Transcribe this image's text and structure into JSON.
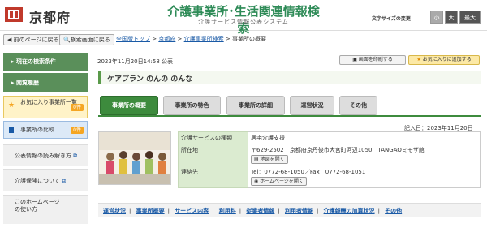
{
  "header": {
    "pref_name": "京都府",
    "site_title": "介護事業所･生活関連情報検索",
    "site_subtitle": "介護サービス情報公表システム",
    "font_size_label": "文字サイズの変更",
    "font_sizes": [
      "小",
      "大",
      "最大"
    ]
  },
  "nav": {
    "back_label": "前のページに戻る",
    "search_back_label": "検索画面に戻る",
    "breadcrumbs": [
      "全国版トップ",
      "京都府",
      "介護事業所検索",
      "事業所の概要"
    ]
  },
  "sidebar": {
    "items": [
      {
        "label": "現在の検索条件"
      },
      {
        "label": "閲覧履歴"
      },
      {
        "label": "お気に入り事業所一覧",
        "count": "0件"
      },
      {
        "label": "事業所の比較",
        "count": "0件"
      },
      {
        "label": "公表情報の読み解き方"
      },
      {
        "label": "介護保険について"
      },
      {
        "label": "このホームページの使い方"
      }
    ]
  },
  "main": {
    "date_line": "2023年11月20日14:58 公表",
    "print_label": "画面を印刷する",
    "favorite_label": "お気に入りに追加する",
    "org_name": "ケアプラン のんの のんな",
    "tabs": [
      {
        "label": "事業所の概要",
        "active": true
      },
      {
        "label": "事業所の特色",
        "active": false
      },
      {
        "label": "事業所の詳細",
        "active": false
      },
      {
        "label": "運営状況",
        "active": false
      },
      {
        "label": "その他",
        "active": false
      }
    ],
    "entry_date": "記入日：2023年11月20日",
    "info": {
      "service_label": "介護サービスの種類",
      "service_value": "居宅介護支援",
      "address_label": "所在地",
      "address_value": "〒629-2502　京都府京丹後市大宮町河辺1050　TANGAOミモザ館",
      "map_button": "地図を開く",
      "contact_label": "連絡先",
      "contact_value": "Tel：0772-68-1050／Fax：0772-68-1051",
      "homepage_button": "ホームページを開く"
    },
    "footer_links": [
      "運営状況",
      "事業所概要",
      "サービス内容",
      "利用料",
      "従業者情報",
      "利用者情報",
      "介護報酬の加算状況",
      "その他"
    ]
  },
  "colors": {
    "brand_green": "#3d8b3d",
    "site_title_green": "#2e8b57",
    "link_blue": "#1a5aa6",
    "badge_orange": "#f5a623"
  }
}
